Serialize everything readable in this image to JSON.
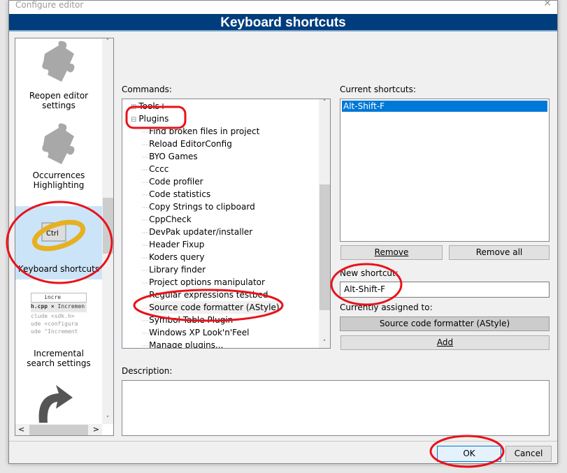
{
  "window": {
    "title": "Configure editor",
    "close_icon": "close-icon"
  },
  "banner": {
    "title": "Keyboard shortcuts"
  },
  "sidebar": {
    "items": [
      {
        "label": "Reopen editor settings",
        "icon": "puzzle-icon"
      },
      {
        "label": "Occurrences Highlighting",
        "icon": "puzzle-icon"
      },
      {
        "label": "Keyboard shortcuts",
        "icon": "keyboard-ring-icon",
        "selected": true
      },
      {
        "label": "Incremental search settings",
        "icon": "incremental-search-icon",
        "thumb_search": "incre",
        "thumb_tab1": "h.cpp",
        "thumb_tab2": "Incremen"
      },
      {
        "label": "",
        "icon": "refactor-arrow-icon"
      }
    ]
  },
  "commands": {
    "label": "Commands:",
    "tree": [
      {
        "label": "Tools+",
        "level": 0,
        "expander": "+"
      },
      {
        "label": "Plugins",
        "level": 0,
        "expander": "-"
      },
      {
        "label": "Find broken files in project",
        "level": 1
      },
      {
        "label": "Reload EditorConfig",
        "level": 1
      },
      {
        "label": "BYO Games",
        "level": 1
      },
      {
        "label": "Cccc",
        "level": 1
      },
      {
        "label": "Code profiler",
        "level": 1
      },
      {
        "label": "Code statistics",
        "level": 1
      },
      {
        "label": "Copy Strings to clipboard",
        "level": 1
      },
      {
        "label": "CppCheck",
        "level": 1
      },
      {
        "label": "DevPak updater/installer",
        "level": 1
      },
      {
        "label": "Header Fixup",
        "level": 1
      },
      {
        "label": "Koders query",
        "level": 1
      },
      {
        "label": "Library finder",
        "level": 1
      },
      {
        "label": "Project options manipulator",
        "level": 1
      },
      {
        "label": "Regular expressions testbed",
        "level": 1
      },
      {
        "label": "Source code formatter (AStyle)",
        "level": 1,
        "selected": true
      },
      {
        "label": "Symbol Table Plugin",
        "level": 1
      },
      {
        "label": "Windows XP Look'n'Feel",
        "level": 1
      },
      {
        "label": "Manage plugins...",
        "level": 1
      }
    ]
  },
  "current_shortcuts": {
    "label": "Current shortcuts:",
    "items": [
      "Alt-Shift-F"
    ],
    "selected_color": "#0078d7"
  },
  "buttons": {
    "remove": "Remove",
    "remove_all": "Remove all",
    "add": "Add",
    "ok": "OK",
    "cancel": "Cancel"
  },
  "new_shortcut": {
    "label": "New shortcut:",
    "value": "Alt-Shift-F"
  },
  "assigned": {
    "label": "Currently assigned to:",
    "value": "Source code formatter (AStyle)"
  },
  "description": {
    "label": "Description:",
    "value": ""
  },
  "annotation_color": "#e8121a"
}
